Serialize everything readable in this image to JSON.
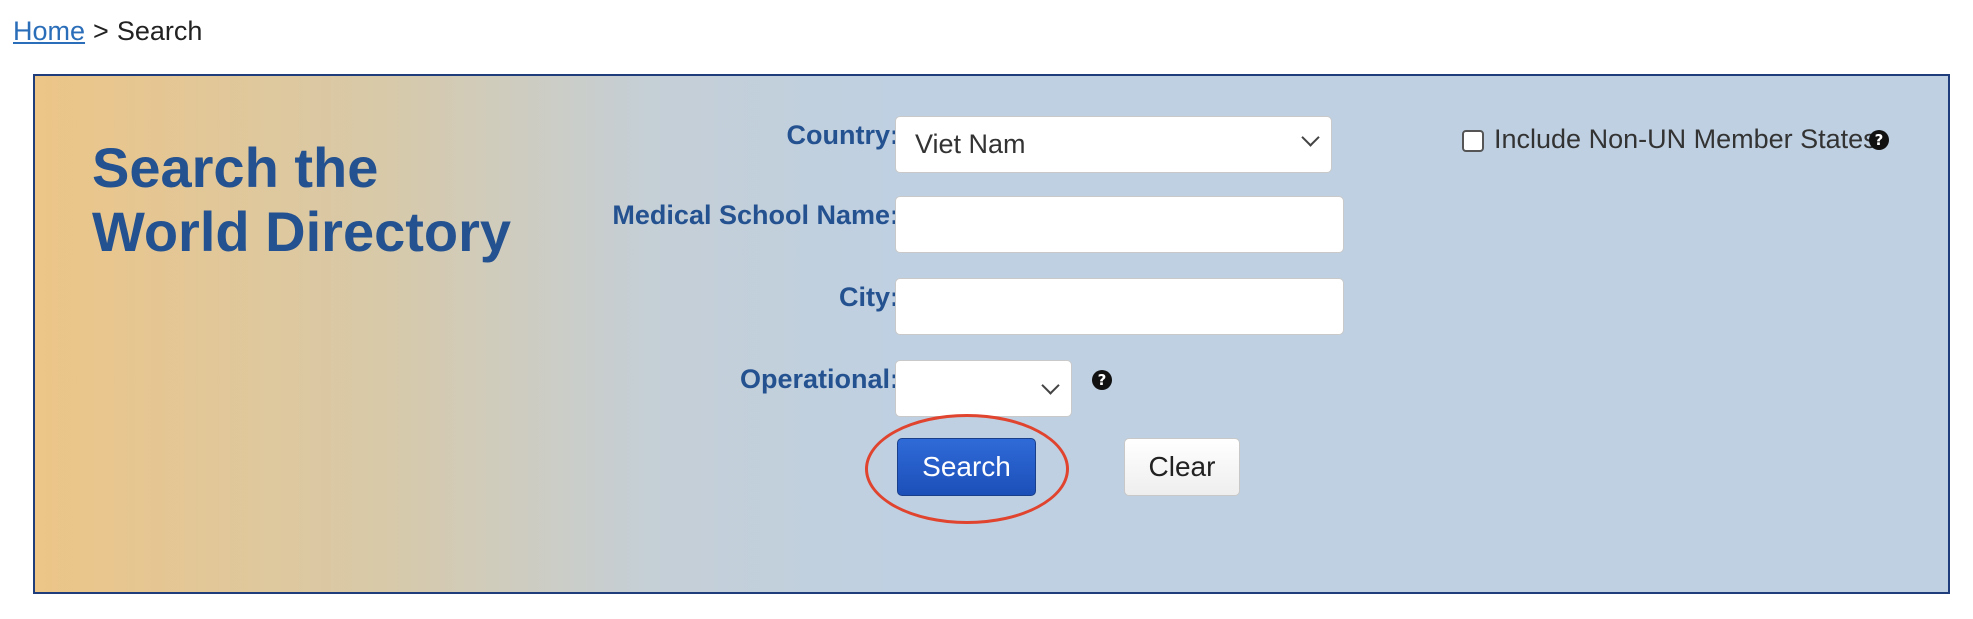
{
  "breadcrumb": {
    "home_label": "Home",
    "separator": ">",
    "current_label": "Search"
  },
  "panel": {
    "title_line1": "Search the",
    "title_line2": "World Directory"
  },
  "form": {
    "country": {
      "label": "Country:",
      "selected_value": "Viet Nam"
    },
    "school_name": {
      "label": "Medical School Name:",
      "value": ""
    },
    "city": {
      "label": "City:",
      "value": ""
    },
    "operational": {
      "label": "Operational:",
      "selected_value": "",
      "help_icon": "question-circle-icon"
    },
    "include_non_un": {
      "label": "Include Non-UN Member States",
      "checked": false,
      "help_icon": "question-circle-icon"
    },
    "search_button_label": "Search",
    "clear_button_label": "Clear"
  },
  "colors": {
    "title_blue": "#24518f",
    "search_button_blue": "#1c4fb8",
    "highlight_red": "#e0432e",
    "panel_border": "#1f3d7a"
  }
}
